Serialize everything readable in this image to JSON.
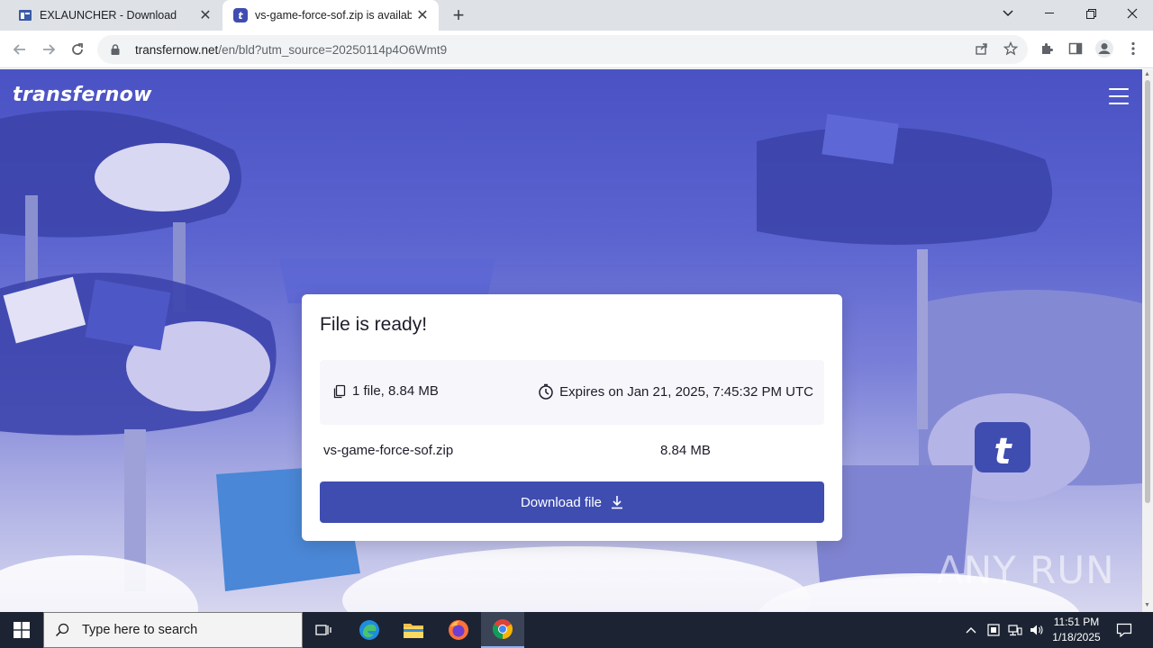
{
  "browser": {
    "tabs": [
      {
        "title": "EXLAUNCHER - Download",
        "active": false
      },
      {
        "title": "vs-game-force-sof.zip is availab",
        "active": true
      }
    ],
    "url_domain": "transfernow.net",
    "url_path": "/en/bld?utm_source=20250114p4O6Wmt9"
  },
  "site": {
    "brand": "transfernow",
    "card": {
      "title": "File is ready!",
      "files_summary": "1 file, 8.84 MB",
      "expiry": "Expires on Jan 21, 2025, 7:45:32 PM UTC",
      "file_name": "vs-game-force-sof.zip",
      "file_size": "8.84 MB",
      "download_label": "Download file"
    },
    "accent_color": "#3f4db1"
  },
  "watermark": "ANY RUN",
  "taskbar": {
    "search_placeholder": "Type here to search",
    "time": "11:51 PM",
    "date": "1/18/2025"
  }
}
